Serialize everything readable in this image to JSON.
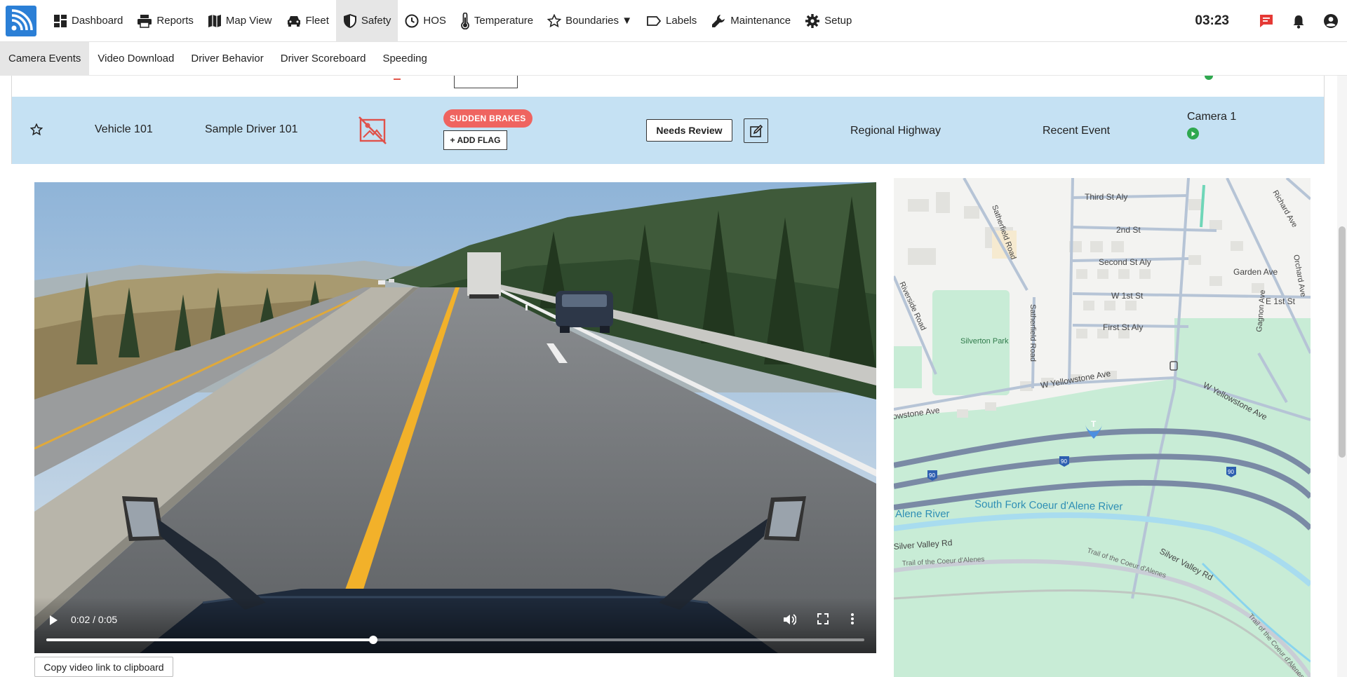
{
  "nav": {
    "items": [
      {
        "label": "Dashboard"
      },
      {
        "label": "Reports"
      },
      {
        "label": "Map View"
      },
      {
        "label": "Fleet"
      },
      {
        "label": "Safety"
      },
      {
        "label": "HOS"
      },
      {
        "label": "Temperature"
      },
      {
        "label": "Boundaries ▼"
      },
      {
        "label": "Labels"
      },
      {
        "label": "Maintenance"
      },
      {
        "label": "Setup"
      }
    ],
    "active": "Safety",
    "clock": "03:23"
  },
  "subnav": {
    "items": [
      {
        "label": "Camera Events"
      },
      {
        "label": "Video Download"
      },
      {
        "label": "Driver Behavior"
      },
      {
        "label": "Driver Scoreboard"
      },
      {
        "label": "Speeding"
      }
    ],
    "active": "Camera Events"
  },
  "event": {
    "vehicle": "Vehicle 101",
    "driver": "Sample Driver 101",
    "flag": "SUDDEN BRAKES",
    "add_flag": "+ ADD FLAG",
    "status": "Needs Review",
    "location": "Regional Highway",
    "recency": "Recent Event",
    "camera": "Camera 1"
  },
  "video": {
    "current": "0:02",
    "duration": "0:05",
    "time_label": "0:02 / 0:05",
    "progress": 0.4,
    "copy_label": "Copy video link to clipboard"
  },
  "map": {
    "labels": {
      "third_st": "Third St Aly",
      "second_st": "2nd St",
      "second_aly": "Second St Aly",
      "w1st": "W 1st St",
      "first_aly": "First St Aly",
      "satherfield_road": "Satherfield Road",
      "satherfield_rd2": "Satherfield Road",
      "garden": "Garden Ave",
      "e1st": "E 1st St",
      "orchard": "Orchard Ave",
      "richard": "Richard Ave",
      "gagnon": "Gagnon Ave",
      "riverside": "Riverside Road",
      "silverton_park": "Silverton Park",
      "w_yellowstone": "W Yellowstone Ave",
      "w_yellowstone2": "W Yellowstone Ave",
      "yellowstone_left": "Yellowstone Ave",
      "alene_river": "Alene River",
      "south_fork": "South Fork Coeur d'Alene River",
      "silver_valley_left": "Silver Valley Rd",
      "silver_valley_right": "Silver Valley Rd",
      "trail_left": "Trail of the Coeur d'Alenes",
      "trail_mid": "Trail of the Coeur d'Alenes",
      "trail_right": "Trail of the Coeur d'Alenes",
      "route_90": "90",
      "transit": "T"
    }
  },
  "colors": {
    "row_highlight": "#c5e1f3",
    "flag_badge": "#ef6460",
    "brand": "#2b7fd6",
    "camera_ok": "#2fa84f",
    "map_park": "#c8ecd6"
  }
}
